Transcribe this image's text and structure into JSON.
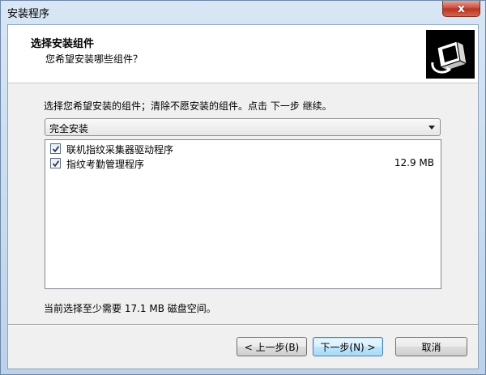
{
  "window": {
    "title": "安装程序",
    "close_label": "x"
  },
  "header": {
    "title": "选择安装组件",
    "subtitle": "您希望安装哪些组件？",
    "icon": "installer-icon"
  },
  "instruction": "选择您希望安装的组件；清除不愿安装的组件。点击 下一步 继续。",
  "install_type": {
    "selected": "完全安装"
  },
  "components": [
    {
      "label": "联机指纹采集器驱动程序",
      "checked": true,
      "size": ""
    },
    {
      "label": "指纹考勤管理程序",
      "checked": true,
      "size": "12.9 MB"
    }
  ],
  "disk_space": "当前选择至少需要 17.1 MB 磁盘空间。",
  "buttons": {
    "back": "< 上一步(B)",
    "next": "下一步(N) >",
    "cancel": "取消"
  }
}
